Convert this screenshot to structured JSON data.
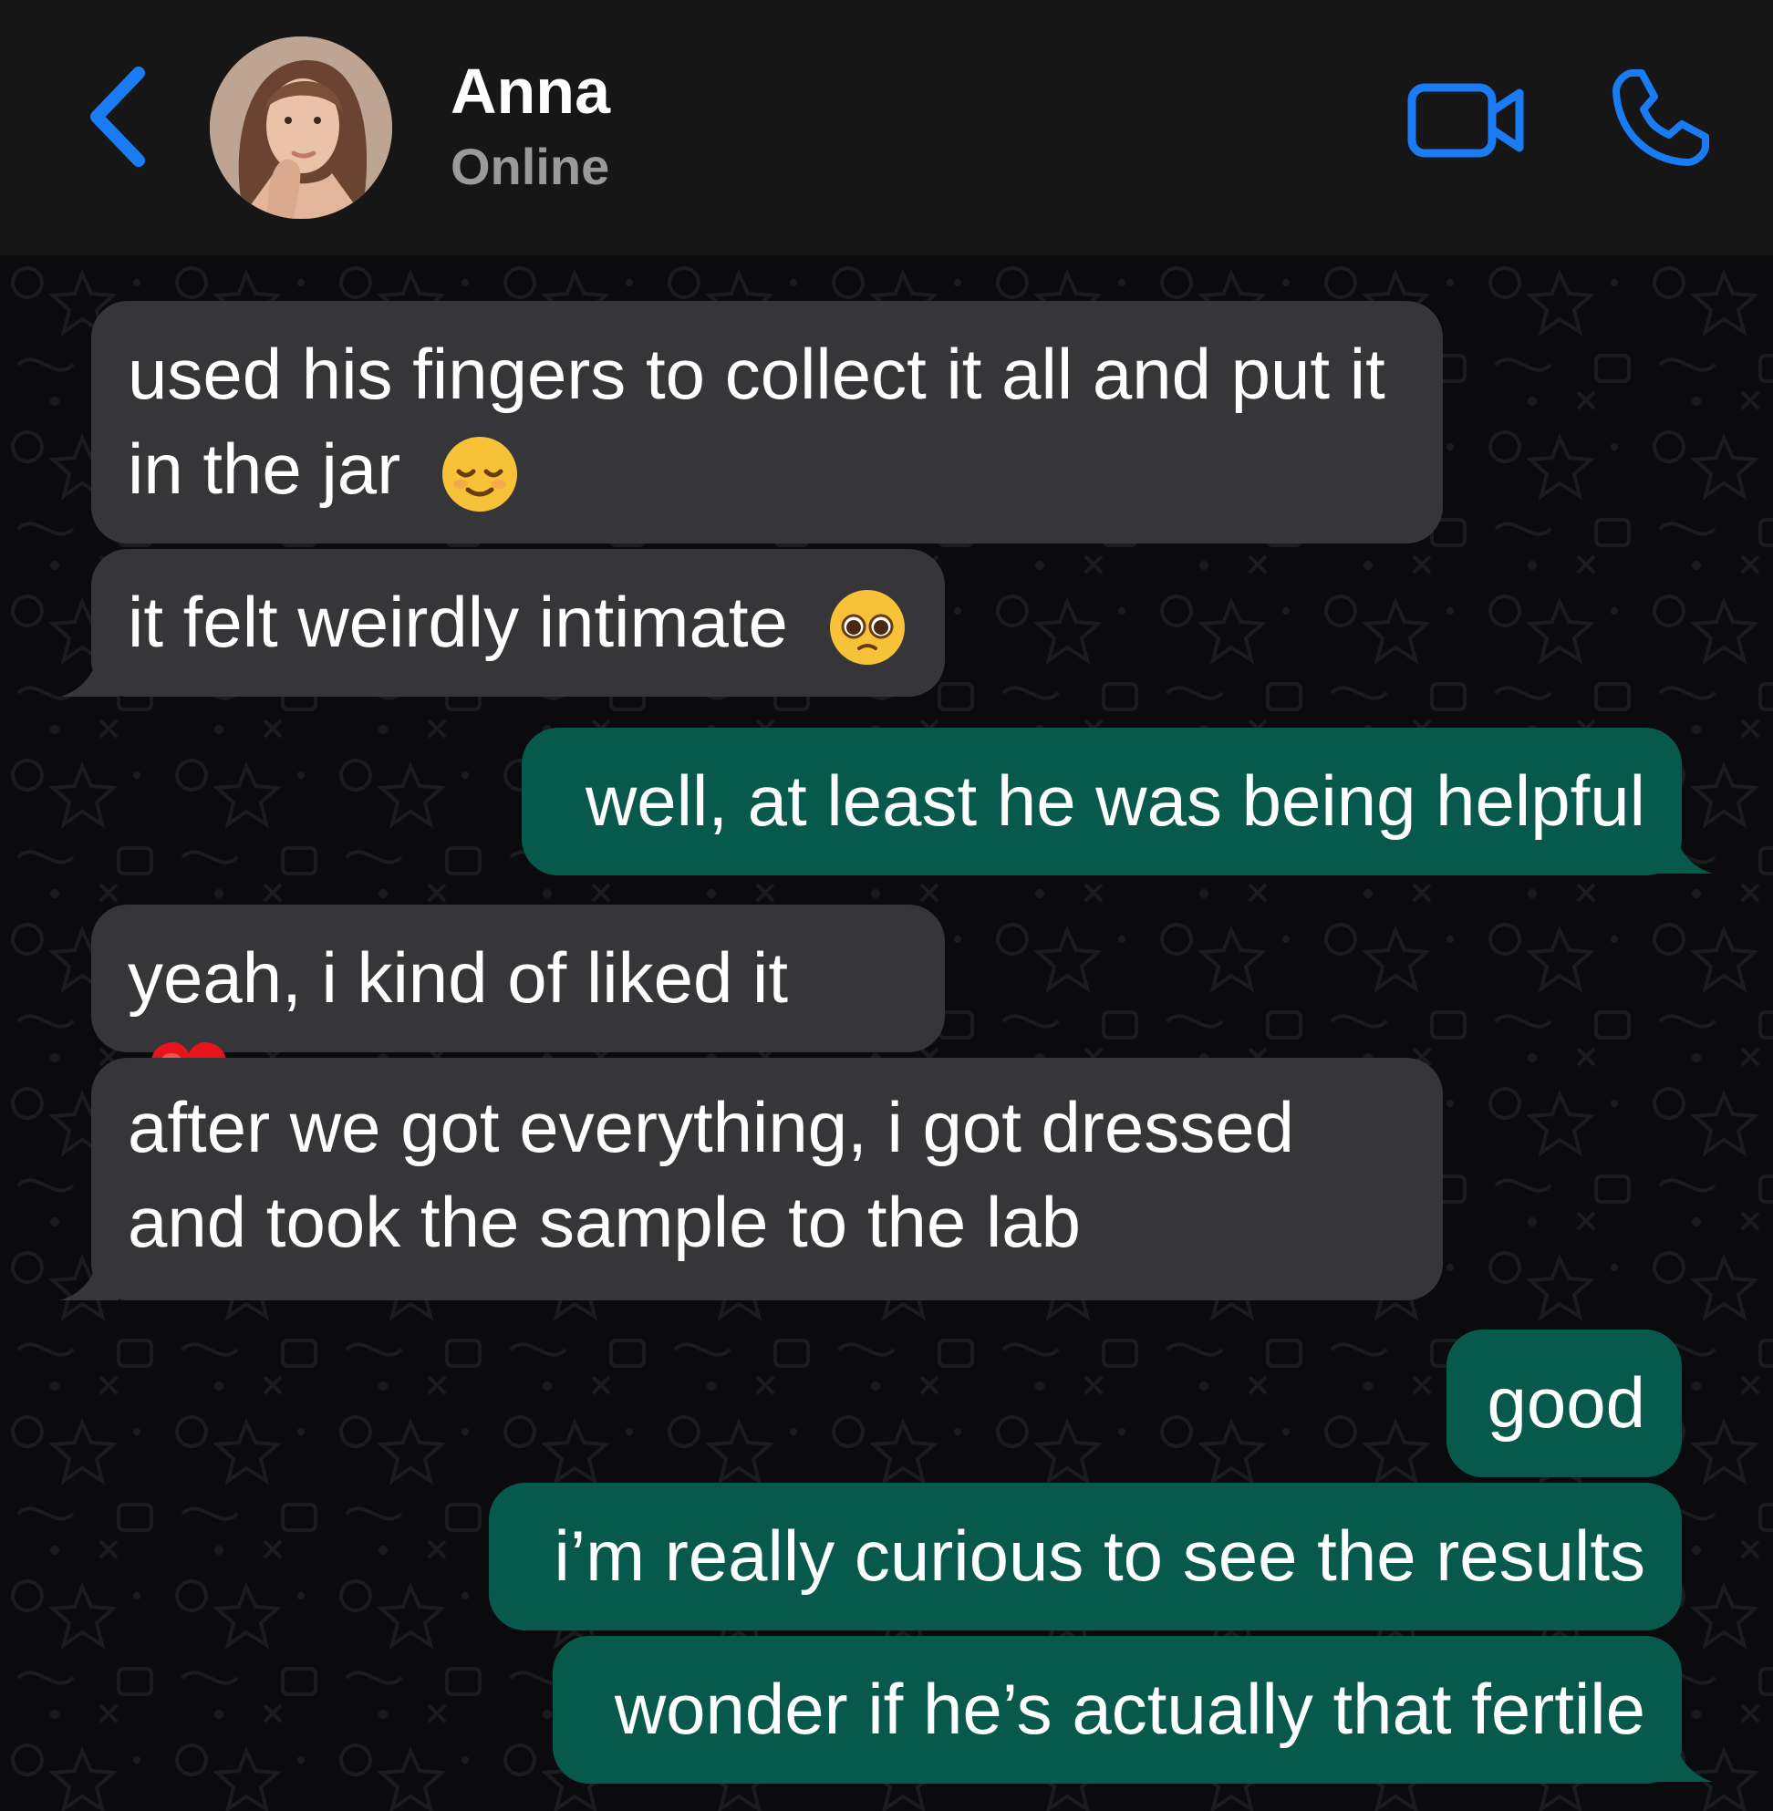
{
  "header": {
    "contact_name": "Anna",
    "status": "Online",
    "back_icon": "chevron-left-icon",
    "video_icon": "video-camera-icon",
    "call_icon": "phone-icon"
  },
  "colors": {
    "accent": "#1a7cf5",
    "header_bg": "#161616",
    "chat_bg": "#0b0b0d",
    "incoming_bubble": "#363638",
    "outgoing_bubble": "#075a4b"
  },
  "messages": [
    {
      "direction": "incoming",
      "text": "used his fingers to collect it all and put it in the jar",
      "emoji": "relieved-face"
    },
    {
      "direction": "incoming",
      "text": "it felt weirdly intimate",
      "emoji": "pleading-face"
    },
    {
      "direction": "outgoing",
      "text": "well, at least he was being helpful"
    },
    {
      "direction": "incoming",
      "text": "yeah, i kind of liked it",
      "emoji": "red-heart"
    },
    {
      "direction": "incoming",
      "text": "after we got everything, i got dressed and took the sample to the lab"
    },
    {
      "direction": "outgoing",
      "text": "good"
    },
    {
      "direction": "outgoing",
      "text": "i’m really curious to see the results"
    },
    {
      "direction": "outgoing",
      "text": "wonder if he’s actually that fertile"
    }
  ]
}
